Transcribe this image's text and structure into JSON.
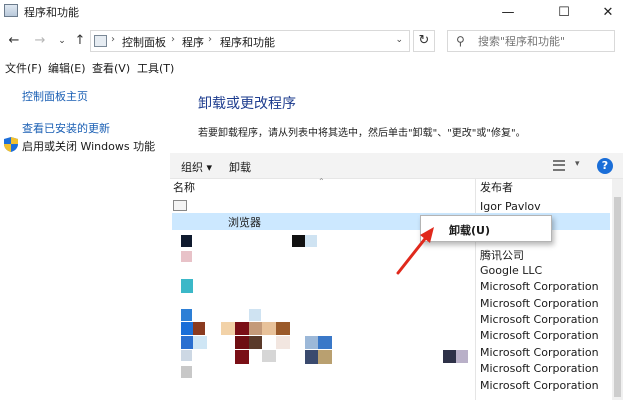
{
  "window": {
    "title": "程序和功能",
    "min_glyph": "—",
    "max_glyph": "☐",
    "close_glyph": "✕"
  },
  "nav": {
    "back_glyph": "←",
    "forward_glyph": "→",
    "recent_glyph": "⌄",
    "up_glyph": "↑",
    "refresh_glyph": "↻"
  },
  "address": {
    "crumbs": [
      "控制面板",
      "程序",
      "程序和功能"
    ],
    "separator": "›",
    "dropdown_glyph": "⌄"
  },
  "search": {
    "placeholder": "搜索\"程序和功能\"",
    "icon_glyph": "⚲"
  },
  "menubar": [
    "文件(F)",
    "编辑(E)",
    "查看(V)",
    "工具(T)"
  ],
  "leftpanel": {
    "home": "控制面板主页",
    "installed_updates": "查看已安装的更新",
    "windows_features": "启用或关闭 Windows 功能"
  },
  "main": {
    "heading": "卸载或更改程序",
    "description": "若要卸载程序，请从列表中将其选中，然后单击\"卸载\"、\"更改\"或\"修复\"。"
  },
  "toolbar": {
    "organize": "组织 ▾",
    "uninstall": "卸载",
    "help_glyph": "?",
    "view_dd_glyph": "▾"
  },
  "columns": {
    "name": "名称",
    "publisher": "发布者",
    "sort_glyph": "⌃"
  },
  "programs": [
    {
      "name": "",
      "publisher": "Igor Pavlov"
    },
    {
      "name": "浏览器",
      "publisher": ""
    },
    {
      "name": "",
      "publisher": ""
    },
    {
      "name": "",
      "publisher": "腾讯公司"
    },
    {
      "name": "",
      "publisher": "Google LLC"
    },
    {
      "name": "",
      "publisher": "Microsoft Corporation"
    },
    {
      "name": "",
      "publisher": "Microsoft Corporation"
    },
    {
      "name": "",
      "publisher": "Microsoft Corporation"
    },
    {
      "name": "",
      "publisher": "Microsoft Corporation"
    },
    {
      "name": "",
      "publisher": "Microsoft Corporation"
    },
    {
      "name": "",
      "publisher": "Microsoft Corporation"
    },
    {
      "name": "",
      "publisher": "Microsoft Corporation"
    }
  ],
  "context_menu": {
    "uninstall": "卸载(U)"
  },
  "colors": {
    "link": "#1a5fb4",
    "heading": "#1e3d8f",
    "selection": "#cce8ff",
    "annotation_arrow": "#e0291c"
  }
}
